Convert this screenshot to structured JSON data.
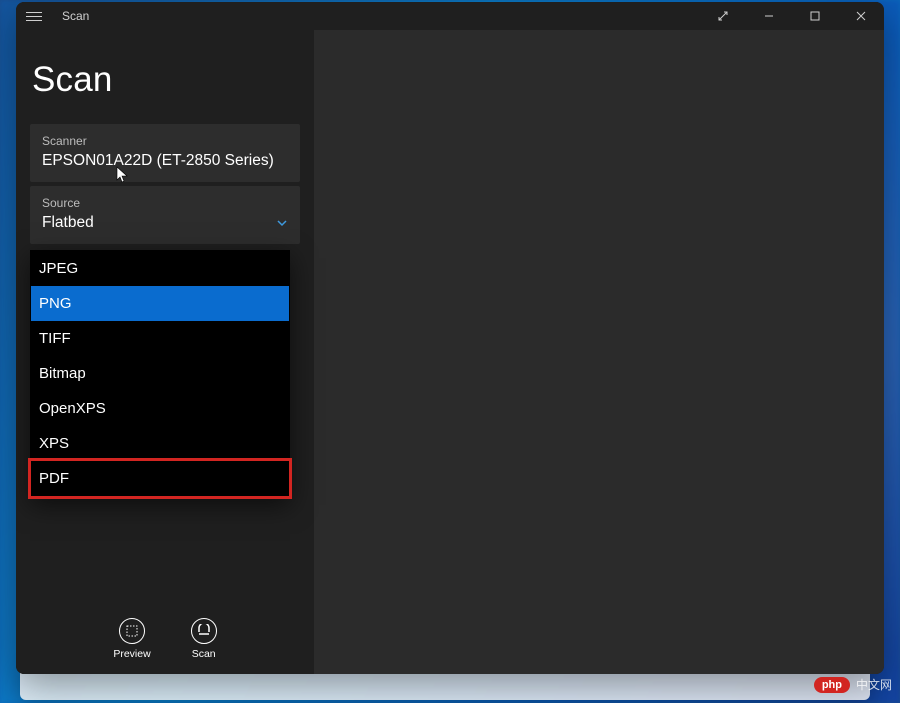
{
  "app": {
    "title": "Scan",
    "page_title": "Scan"
  },
  "scanner_field": {
    "label": "Scanner",
    "value": "EPSON01A22D (ET-2850 Series)"
  },
  "source_field": {
    "label": "Source",
    "value": "Flatbed"
  },
  "filetype_dropdown": {
    "options": [
      "JPEG",
      "PNG",
      "TIFF",
      "Bitmap",
      "OpenXPS",
      "XPS",
      "PDF"
    ],
    "selected": "PNG",
    "highlighted": "PDF"
  },
  "actions": {
    "preview": "Preview",
    "scan": "Scan"
  },
  "watermark": {
    "badge": "php",
    "text": "中文网"
  }
}
